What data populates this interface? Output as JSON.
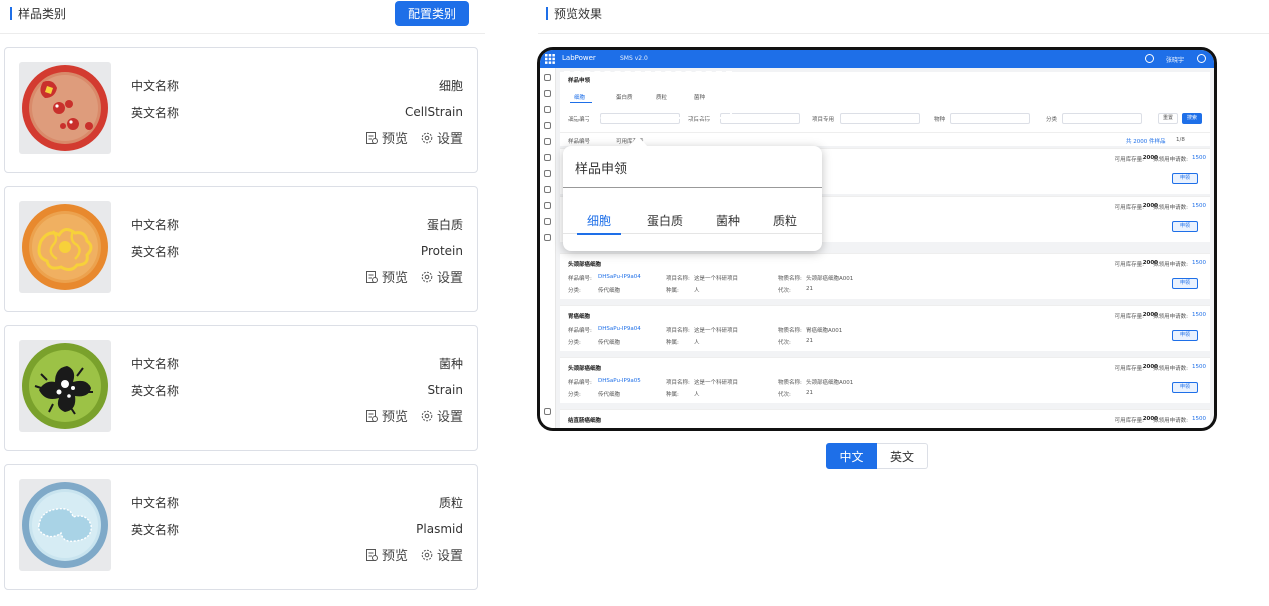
{
  "left": {
    "title": "样品类别",
    "config_button": "配置类别",
    "cards": [
      {
        "cn_label": "中文名称",
        "cn_value": "细胞",
        "en_label": "英文名称",
        "en_value": "CellStrain",
        "preview": "预览",
        "settings": "设置",
        "image": "cell-dish",
        "color": "#d9483b"
      },
      {
        "cn_label": "中文名称",
        "cn_value": "蛋白质",
        "en_label": "英文名称",
        "en_value": "Protein",
        "preview": "预览",
        "settings": "设置",
        "image": "protein-dish",
        "color": "#e69a3a"
      },
      {
        "cn_label": "中文名称",
        "cn_value": "菌种",
        "en_label": "英文名称",
        "en_value": "Strain",
        "preview": "预览",
        "settings": "设置",
        "image": "strain-dish",
        "color": "#8db33a"
      },
      {
        "cn_label": "中文名称",
        "cn_value": "质粒",
        "en_label": "英文名称",
        "en_value": "Plasmid",
        "preview": "预览",
        "settings": "设置",
        "image": "plasmid-dish",
        "color": "#8fb8d6"
      }
    ]
  },
  "right": {
    "title": "预览效果",
    "preview": {
      "brand": "LabPower",
      "version": "SMS v2.0",
      "user": "张晓宇",
      "page_title": "样品申领",
      "tabs": [
        "细胞",
        "蛋白质",
        "质粒",
        "菌种"
      ],
      "filters": [
        "细胞编号",
        "项目名称",
        "项目专用",
        "物种",
        "分类"
      ],
      "placeholder": "请选择",
      "reset": "重置",
      "search": "搜索",
      "sort": [
        "样品编号",
        "可用库存量"
      ],
      "total": "共 2000 件样品",
      "page": "1/8",
      "records": [
        {
          "name": "头颈部癌细胞",
          "code": "DHSaPu-IP9a04",
          "proj": "这是一个科研项目",
          "full": "头颈部癌细胞A001",
          "cat": "传代细胞",
          "species": "人",
          "gen": "21"
        },
        {
          "name": "胃癌细胞",
          "code": "DHSaPu-IP9a04",
          "proj": "这是一个科研项目",
          "full": "胃癌细胞A001",
          "cat": "传代细胞",
          "species": "人",
          "gen": "21"
        },
        {
          "name": "头颈部癌细胞",
          "code": "DHSaPu-IP9a05",
          "proj": "这是一个科研项目",
          "full": "头颈部癌细胞A001",
          "cat": "传代细胞",
          "species": "人",
          "gen": "21"
        },
        {
          "name": "结直肠癌细胞",
          "code": "",
          "proj": "",
          "full": "",
          "cat": "",
          "species": "",
          "gen": ""
        }
      ],
      "stock_label": "可用库存量:",
      "stock_value": "2000",
      "apply_label": "拟领用申请数:",
      "apply_value": "1500",
      "apply_btn": "申领",
      "field_labels": {
        "code": "样品编号:",
        "proj": "项目名称:",
        "full": "物质名称:",
        "cat": "分类:",
        "species": "种属:",
        "gen": "代次:"
      }
    },
    "callout": {
      "title": "样品申领",
      "tabs": [
        "细胞",
        "蛋白质",
        "菌种",
        "质粒"
      ]
    },
    "lang": {
      "zh": "中文",
      "en": "英文"
    }
  },
  "colors": {
    "accent": "#1e6fe8"
  }
}
